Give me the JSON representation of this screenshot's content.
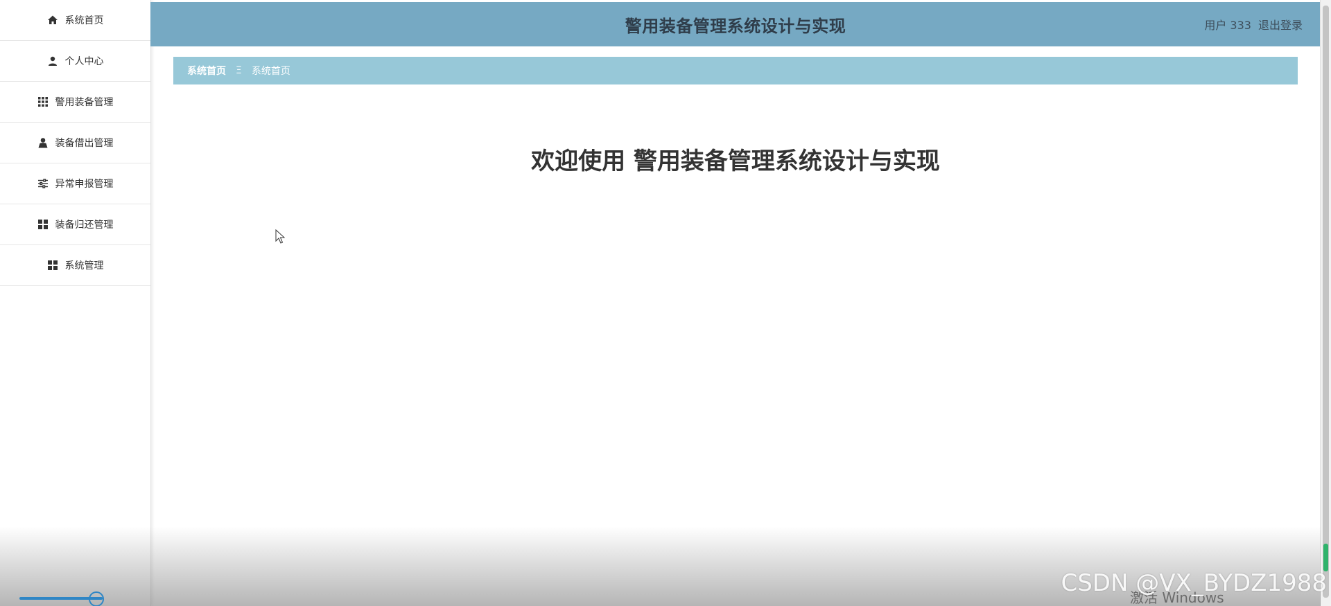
{
  "sidebar": {
    "items": [
      {
        "label": "系统首页",
        "icon": "home-icon"
      },
      {
        "label": "个人中心",
        "icon": "user-icon"
      },
      {
        "label": "警用装备管理",
        "icon": "grid-icon"
      },
      {
        "label": "装备借出管理",
        "icon": "person-icon"
      },
      {
        "label": "异常申报管理",
        "icon": "sliders-icon"
      },
      {
        "label": "装备归还管理",
        "icon": "apps-icon"
      },
      {
        "label": "系统管理",
        "icon": "apps-icon"
      }
    ]
  },
  "header": {
    "title": "警用装备管理系统设计与实现",
    "user_label": "用户 333",
    "logout_label": "退出登录",
    "background": "#76a9c3"
  },
  "breadcrumb": {
    "home": "系统首页",
    "separator": "Ξ",
    "current": "系统首页",
    "background": "#97c8d8"
  },
  "main": {
    "welcome_text": "欢迎使用 警用装备管理系统设计与实现"
  },
  "overlay": {
    "watermark": "CSDN @VX_BYDZ1988",
    "activate_text": "激活 Windows"
  }
}
